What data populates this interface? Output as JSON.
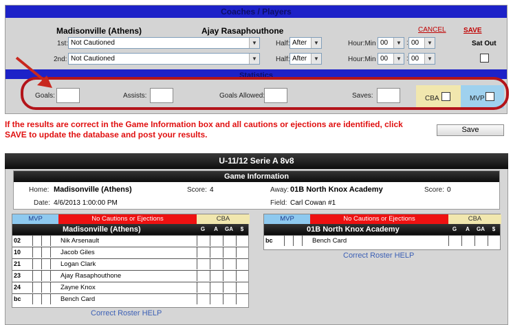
{
  "coaches_panel": {
    "header": "Coaches / Players",
    "team": "Madisonville (Athens)",
    "player": "Ajay Rasaphouthone",
    "cancel_label": "CANCEL",
    "save_label": "SAVE",
    "sat_out_label": "Sat Out",
    "first_label": "1st:",
    "second_label": "2nd:",
    "first_caution": "Not Cautioned",
    "second_caution": "Not Cautioned",
    "half_label": "Half:",
    "first_half": "After",
    "second_half": "After",
    "hourmin_label": "Hour:Min",
    "first_hour": "00",
    "first_min": "00",
    "second_hour": "00",
    "second_min": "00"
  },
  "statistics": {
    "header": "Statistics",
    "goals_label": "Goals:",
    "assists_label": "Assists:",
    "goals_allowed_label": "Goals Allowed:",
    "saves_label": "Saves:",
    "cba_label": "CBA",
    "mvp_label": "MVP"
  },
  "message": "If the results are correct in the Game Information box and all cautions or ejections are identified, click SAVE to update the database and post your results.",
  "save_button": "Save",
  "division_title": "U-11/12 Serie A 8v8",
  "game_info": {
    "header": "Game Information",
    "home_label": "Home:",
    "home_team": "Madisonville (Athens)",
    "home_score_label": "Score:",
    "home_score": "4",
    "away_label": "Away:",
    "away_team": "01B North Knox Academy",
    "away_score_label": "Score:",
    "away_score": "0",
    "date_label": "Date:",
    "date": "4/6/2013 1:00:00 PM",
    "field_label": "Field:",
    "field": "Carl Cowan #1"
  },
  "roster_columns": {
    "mvp": "MVP",
    "no_cautions": "No Cautions or Ejections",
    "cba": "CBA",
    "g": "G",
    "a": "A",
    "ga": "GA",
    "s": "$"
  },
  "home_roster": {
    "team": "Madisonville (Athens)",
    "players": [
      {
        "num": "02",
        "name": "Nik Arsenault"
      },
      {
        "num": "10",
        "name": "Jacob Giles"
      },
      {
        "num": "21",
        "name": "Logan Clark"
      },
      {
        "num": "23",
        "name": "Ajay Rasaphouthone"
      },
      {
        "num": "24",
        "name": "Zayne Knox"
      },
      {
        "num": "bc",
        "name": "Bench Card"
      }
    ],
    "help": "Correct Roster HELP"
  },
  "away_roster": {
    "team": "01B North Knox Academy",
    "players": [
      {
        "num": "bc",
        "name": "Bench Card"
      }
    ],
    "help": "Correct Roster HELP"
  },
  "colors": {
    "header_blue": "#1d22c8",
    "annotation_red": "#b3141a",
    "message_red": "#e01010",
    "mvp_blue": "#8ec9ef",
    "cba_yellow": "#f1e7ae",
    "no_caution_red": "#ee1111"
  }
}
